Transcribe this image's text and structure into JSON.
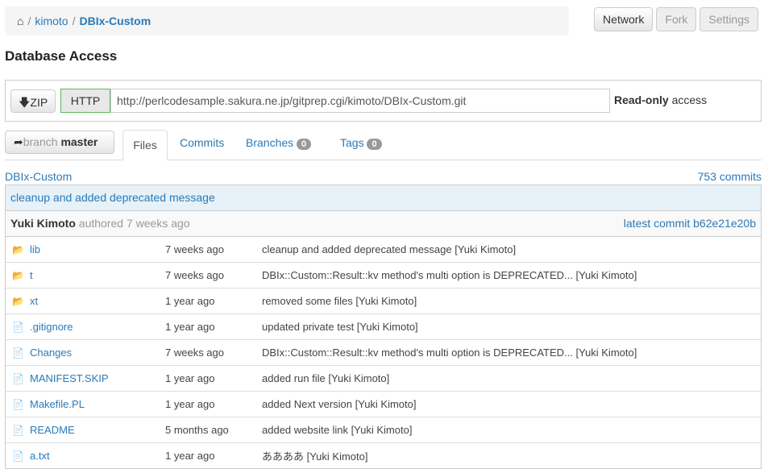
{
  "breadcrumb": {
    "user": "kimoto",
    "repo": "DBIx-Custom"
  },
  "top_buttons": {
    "network": "Network",
    "fork": "Fork",
    "settings": "Settings"
  },
  "section_title": "Database Access",
  "access": {
    "zip": "ZIP",
    "http": "HTTP",
    "url": "http://perlcodesample.sakura.ne.jp/gitprep.cgi/kimoto/DBIx-Custom.git",
    "readonly": "Read-only",
    "access": "access"
  },
  "branch": {
    "label": "branch",
    "name": "master"
  },
  "tabs": {
    "files": "Files",
    "commits": "Commits",
    "branches": "Branches",
    "branches_count": "0",
    "tags": "Tags",
    "tags_count": "0"
  },
  "project": "DBIx-Custom",
  "commit_count": "753 commits",
  "last_commit": {
    "message": "cleanup and added deprecated message",
    "author": "Yuki Kimoto",
    "authored": "authored 7 weeks ago",
    "latest": "latest commit b62e21e20b"
  },
  "files": [
    {
      "name": "lib",
      "type": "dir",
      "age": "7 weeks ago",
      "msg": "cleanup and added deprecated message [Yuki Kimoto]"
    },
    {
      "name": "t",
      "type": "dir",
      "age": "7 weeks ago",
      "msg": "DBIx::Custom::Result::kv method's multi option is DEPRECATED... [Yuki Kimoto]"
    },
    {
      "name": "xt",
      "type": "dir",
      "age": "1 year ago",
      "msg": "removed some files [Yuki Kimoto]"
    },
    {
      "name": ".gitignore",
      "type": "file",
      "age": "1 year ago",
      "msg": "updated private test [Yuki Kimoto]"
    },
    {
      "name": "Changes",
      "type": "file",
      "age": "7 weeks ago",
      "msg": "DBIx::Custom::Result::kv method's multi option is DEPRECATED... [Yuki Kimoto]"
    },
    {
      "name": "MANIFEST.SKIP",
      "type": "file",
      "age": "1 year ago",
      "msg": "added run file [Yuki Kimoto]"
    },
    {
      "name": "Makefile.PL",
      "type": "file",
      "age": "1 year ago",
      "msg": "added Next version [Yuki Kimoto]"
    },
    {
      "name": "README",
      "type": "file",
      "age": "5 months ago",
      "msg": "added website link [Yuki Kimoto]"
    },
    {
      "name": "a.txt",
      "type": "file",
      "age": "1 year ago",
      "msg": "ああああ [Yuki Kimoto]"
    }
  ]
}
